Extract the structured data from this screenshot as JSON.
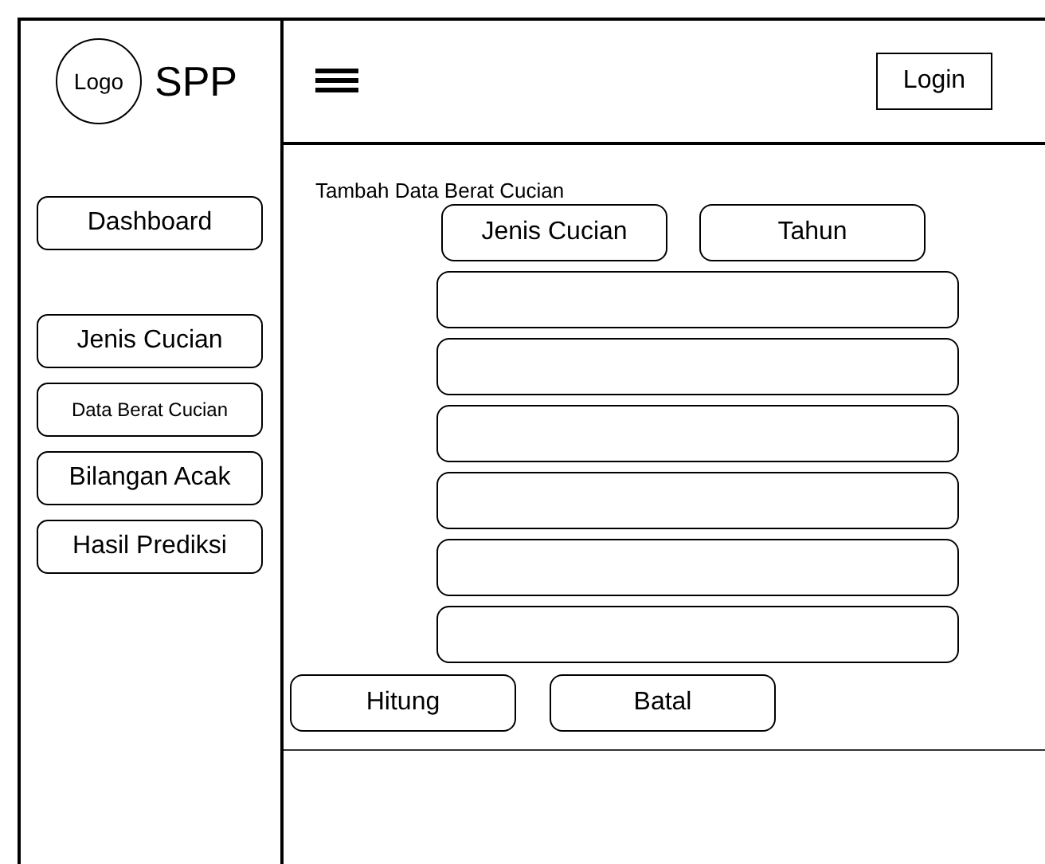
{
  "header": {
    "logo": "Logo",
    "brand": "SPP",
    "login": "Login"
  },
  "sidebar": {
    "dashboard": "Dashboard",
    "items": [
      {
        "label": "Jenis Cucian",
        "kind": "normal"
      },
      {
        "label": "Data Berat Cucian",
        "kind": "small"
      },
      {
        "label": "Bilangan Acak",
        "kind": "normal"
      },
      {
        "label": "Hasil Prediksi",
        "kind": "normal"
      }
    ]
  },
  "form": {
    "title": "Tambah Data Berat Cucian",
    "selectors": [
      "Jenis Cucian",
      "Tahun"
    ],
    "fields": [
      {
        "kind": "text"
      },
      {
        "kind": "text"
      },
      {
        "kind": "text"
      },
      {
        "kind": "text"
      },
      {
        "kind": "text"
      },
      {
        "kind": "text"
      }
    ],
    "buttons": [
      "Hitung",
      "Batal"
    ]
  }
}
